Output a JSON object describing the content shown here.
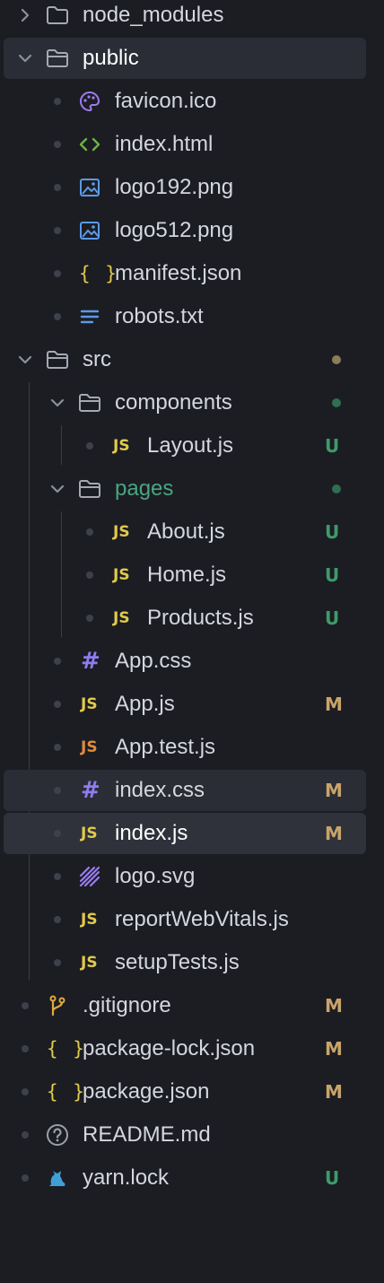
{
  "tree": {
    "node_modules": "node_modules",
    "public": {
      "name": "public",
      "items": [
        "favicon.ico",
        "index.html",
        "logo192.png",
        "logo512.png",
        "manifest.json",
        "robots.txt"
      ]
    },
    "src": {
      "name": "src",
      "components": {
        "name": "components",
        "items": [
          "Layout.js"
        ],
        "statuses": [
          "U"
        ]
      },
      "pages": {
        "name": "pages",
        "items": [
          "About.js",
          "Home.js",
          "Products.js"
        ],
        "statuses": [
          "U",
          "U",
          "U"
        ]
      },
      "items": [
        "App.css",
        "App.js",
        "App.test.js",
        "index.css",
        "index.js",
        "logo.svg",
        "reportWebVitals.js",
        "setupTests.js"
      ],
      "statuses": {
        "app_js": "M",
        "index_css": "M",
        "index_js": "M"
      }
    },
    "root_items": [
      ".gitignore",
      "package-lock.json",
      "package.json",
      "README.md",
      "yarn.lock"
    ],
    "root_statuses": {
      "gitignore": "M",
      "package_lock": "M",
      "package_json": "M",
      "yarn_lock": "U"
    }
  },
  "icon_glyphs": {
    "js": "JS",
    "css": "#",
    "json": "{ }"
  },
  "colors": {
    "background": "#1b1d23",
    "selected_row": "#2f323b",
    "hover_row": "#2a2d35",
    "modified": "#c9a46a",
    "untracked": "#3f9a6a",
    "js_icon": "#e2c94b",
    "css_icon": "#8f7cf0"
  }
}
